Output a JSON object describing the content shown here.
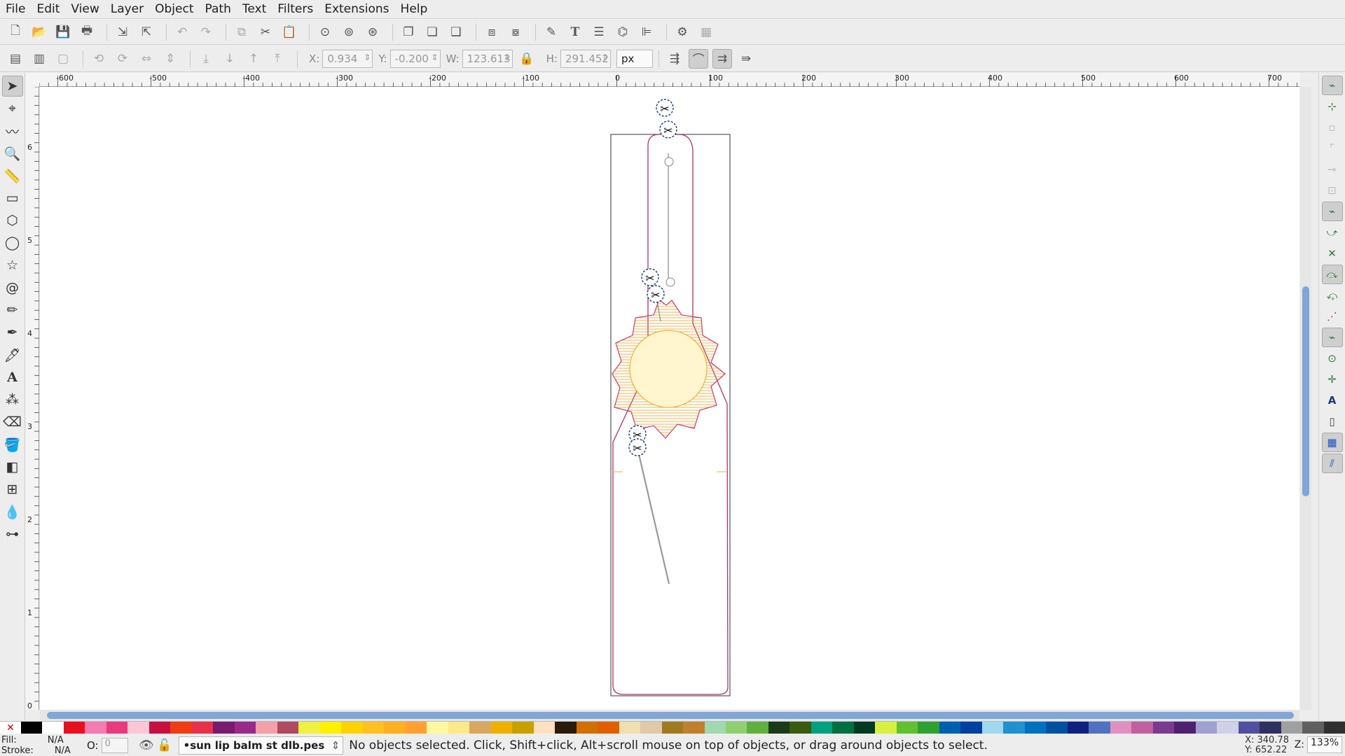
{
  "menu": [
    "File",
    "Edit",
    "View",
    "Layer",
    "Object",
    "Path",
    "Text",
    "Filters",
    "Extensions",
    "Help"
  ],
  "ruler_labels": [
    "-600",
    "-500",
    "-400",
    "-300",
    "-200",
    "-100",
    "0",
    "100",
    "200",
    "300",
    "400",
    "500",
    "600",
    "700"
  ],
  "vruler_labels": [
    "6",
    "5",
    "4",
    "3",
    "2",
    "1",
    "0"
  ],
  "ctrl": {
    "x_label": "X:",
    "x_value": "0.934",
    "y_label": "Y:",
    "y_value": "-0.200",
    "w_label": "W:",
    "w_value": "123.613",
    "h_label": "H:",
    "h_value": "291.452",
    "unit": "px"
  },
  "status": {
    "fill_label": "Fill:",
    "fill_value": "N/A",
    "stroke_label": "Stroke:",
    "stroke_value": "N/A",
    "opacity_label": "O:",
    "opacity_value": "0",
    "layer": "•sun lip balm st dlb.pes",
    "message": "No objects selected. Click, Shift+click, Alt+scroll mouse on top of objects, or drag around objects to select.",
    "x_coord": "X: 340.78",
    "y_coord": "Y: 652.22",
    "zoom_label": "Z:",
    "zoom_value": "133%"
  },
  "colors": {
    "outline": "#b0306a",
    "fill_stitch": "#f0a020",
    "center": "#fff6d0",
    "palette": [
      "#000000",
      "#ffffff",
      "#e8101e",
      "#f47ab0",
      "#e83a7c",
      "#fbc6d6",
      "#c8103e",
      "#f03c14",
      "#e8304a",
      "#7a1a6e",
      "#9a2a8a",
      "#f4a0a8",
      "#b04a5e",
      "#f0f040",
      "#fff000",
      "#ffd200",
      "#ffc020",
      "#ffb020",
      "#ffa030",
      "#fff8a0",
      "#ffe88a",
      "#d8a860",
      "#f0b000",
      "#c8a000",
      "#ffe0c0",
      "#2a1a08",
      "#d07000",
      "#e06000",
      "#f0e0b0",
      "#e0c8a8",
      "#a07a20",
      "#c08030",
      "#a0d8b0",
      "#90d070",
      "#60b040",
      "#1a3a18",
      "#3a5a10",
      "#00a080",
      "#007040",
      "#003a20",
      "#d8f040",
      "#60c030",
      "#30a030",
      "#0060b0",
      "#0040a0",
      "#a0d8f0",
      "#2090d0",
      "#0070c0",
      "#0050a0",
      "#102080",
      "#5070c0",
      "#e090c0",
      "#c060a0",
      "#7a3a90",
      "#502070",
      "#a0a0d0",
      "#d0d0e8",
      "#5050a0",
      "#303060",
      "#a0a0a0",
      "#606060",
      "#303030"
    ]
  },
  "scissors": "✂",
  "tools": [
    "select-tool",
    "node-tool",
    "tweak-tool",
    "zoom-tool",
    "measure-tool",
    "rect-tool",
    "3dbox-tool",
    "ellipse-tool",
    "star-tool",
    "spiral-tool",
    "pencil-tool",
    "pen-tool",
    "calligraphy-tool",
    "text-tool",
    "spray-tool",
    "eraser-tool",
    "bucket-tool",
    "gradient-tool",
    "mesh-tool",
    "dropper-tool",
    "connector-tool"
  ]
}
